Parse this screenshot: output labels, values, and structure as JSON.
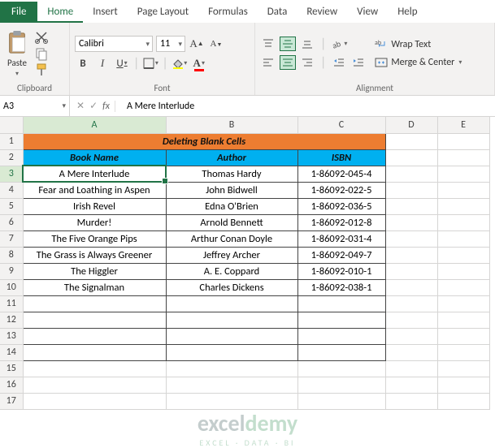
{
  "tabs": {
    "file": "File",
    "items": [
      "Home",
      "Insert",
      "Page Layout",
      "Formulas",
      "Data",
      "Review",
      "View",
      "Help"
    ],
    "active": 0
  },
  "ribbon": {
    "clipboard": {
      "paste": "Paste",
      "label": "Clipboard"
    },
    "font": {
      "name": "Calibri",
      "size": "11",
      "label": "Font",
      "bold": "B",
      "italic": "I",
      "underline": "U"
    },
    "alignment": {
      "label": "Alignment",
      "wrap": "Wrap Text",
      "merge": "Merge & Center"
    }
  },
  "formula_bar": {
    "name_box": "A3",
    "fx": "fx",
    "value": "A Mere Interlude"
  },
  "columns": [
    "A",
    "B",
    "C",
    "D",
    "E"
  ],
  "rows": [
    "1",
    "2",
    "3",
    "4",
    "5",
    "6",
    "7",
    "8",
    "9",
    "10",
    "11",
    "12",
    "13",
    "14",
    "15",
    "16",
    "17"
  ],
  "sheet": {
    "title": "Deleting Blank Cells",
    "headers": [
      "Book Name",
      "Author",
      "ISBN"
    ],
    "data": [
      [
        "A Mere Interlude",
        "Thomas Hardy",
        "1-86092-045-4"
      ],
      [
        "Fear and Loathing in Aspen",
        "John Bidwell",
        "1-86092-022-5"
      ],
      [
        "Irish Revel",
        "Edna O'Brien",
        "1-86092-036-5"
      ],
      [
        "Murder!",
        "Arnold Bennett",
        "1-86092-012-8"
      ],
      [
        "The Five Orange Pips",
        "Arthur Conan Doyle",
        "1-86092-031-4"
      ],
      [
        "The Grass is Always Greener",
        "Jeffrey Archer",
        "1-86092-049-7"
      ],
      [
        "The Higgler",
        "A. E. Coppard",
        "1-86092-010-1"
      ],
      [
        "The Signalman",
        "Charles Dickens",
        "1-86092-038-1"
      ]
    ]
  },
  "watermark": {
    "brand_a": "excel",
    "brand_b": "demy",
    "tag": "EXCEL · DATA · BI"
  },
  "selected_cell": {
    "row": 3,
    "col": "A"
  }
}
